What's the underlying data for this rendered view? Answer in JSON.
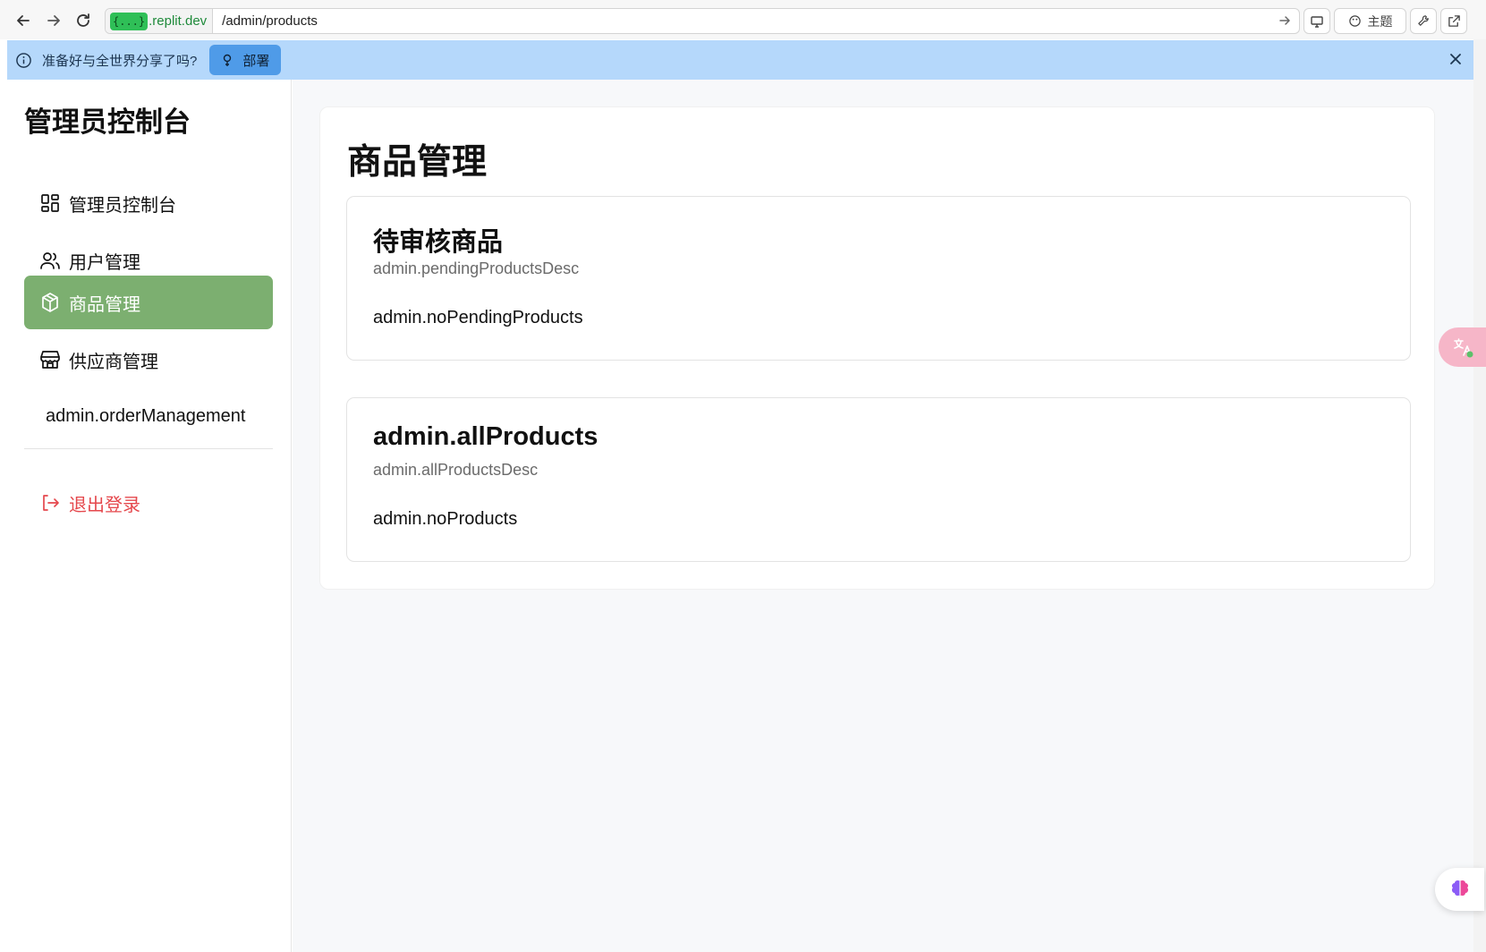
{
  "browser": {
    "host_badge": "{...}",
    "host": ".replit.dev",
    "path": "/admin/products",
    "theme_label": "主题"
  },
  "banner": {
    "message": "准备好与全世界分享了吗?",
    "deploy_label": "部署"
  },
  "sidebar": {
    "title": "管理员控制台",
    "items": [
      {
        "label": "管理员控制台",
        "icon": "dashboard-grid-icon"
      },
      {
        "label": "用户管理",
        "icon": "users-icon"
      },
      {
        "label": "商品管理",
        "icon": "package-icon",
        "active": true
      },
      {
        "label": "供应商管理",
        "icon": "store-icon"
      },
      {
        "label": "admin.orderManagement",
        "icon": ""
      }
    ],
    "logout_label": "退出登录"
  },
  "main": {
    "title": "商品管理",
    "sections": [
      {
        "title": "待审核商品",
        "description": "admin.pendingProductsDesc",
        "empty": "admin.noPendingProducts"
      },
      {
        "title": "admin.allProducts",
        "description": "admin.allProductsDesc",
        "empty": "admin.noProducts"
      }
    ]
  },
  "colors": {
    "active_nav": "#7caf70",
    "banner": "#b5d8fb",
    "deploy_button": "#4f9be8",
    "logout": "#e5484d"
  }
}
